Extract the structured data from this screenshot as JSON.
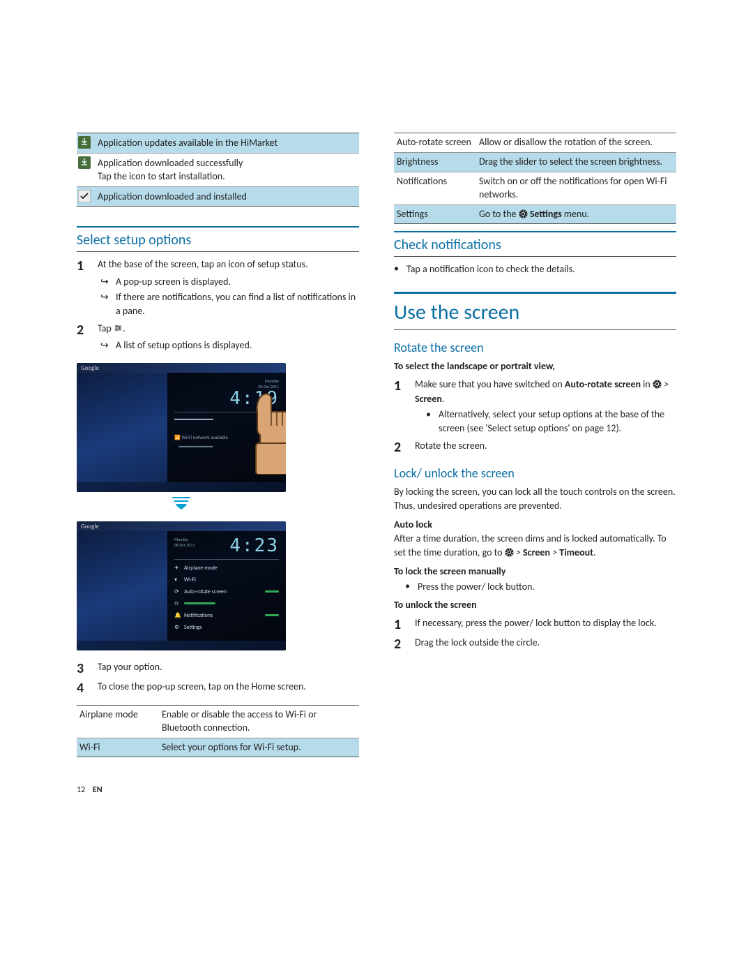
{
  "icon_rows": [
    {
      "icon": "download-available",
      "text": "Application updates available in the HiMarket"
    },
    {
      "icon": "download-done",
      "text": "Application downloaded successfully\nTap the icon to start installation."
    },
    {
      "icon": "installed",
      "text": "Application downloaded and installed"
    }
  ],
  "left": {
    "select_setup_heading": "Select setup options",
    "step1_text": "At the base of the screen, tap an icon of setup status.",
    "step1_sub1": "A pop-up screen is displayed.",
    "step1_sub2": "If there are notifications, you can find a list of notifications in a pane.",
    "step2_text_prefix": "Tap ",
    "step2_text_suffix": ".",
    "step2_sub1": "A list of setup options is displayed.",
    "step3_text": "Tap your option.",
    "step4_text": "To close the pop-up screen, tap on the Home screen.",
    "shot1": {
      "clock": "4:19",
      "search": "Google",
      "lines": [
        "Monday",
        "06 Oct 2011",
        "",
        "Wi-Fi network available"
      ]
    },
    "shot2": {
      "clock": "4:23",
      "search": "Google",
      "date1": "Monday",
      "date2": "06 Oct 2011",
      "rows": [
        {
          "icon": "✈",
          "label": "Airplane mode"
        },
        {
          "icon": "▾",
          "label": "Wi-Fi"
        },
        {
          "icon": "⟳",
          "label": "Auto-rotate screen",
          "toggle": true
        },
        {
          "icon": "☼",
          "label": "",
          "slider": true
        },
        {
          "icon": "🔔",
          "label": "Notifications",
          "toggle": true
        },
        {
          "icon": "⚙",
          "label": "Settings"
        }
      ]
    },
    "opts1": [
      {
        "k": "Airplane mode",
        "v": "Enable or disable the access to Wi-Fi or Bluetooth connection."
      },
      {
        "k": "Wi-Fi",
        "v": "Select your options for Wi-Fi setup."
      }
    ]
  },
  "right": {
    "opts2": [
      {
        "k": "Auto-rotate screen",
        "v": "Allow or disallow the rotation of the screen."
      },
      {
        "k": "Brightness",
        "v": "Drag the slider to select the screen brightness."
      },
      {
        "k": "Notifications",
        "v": "Switch on or off the notifications for open Wi-Fi networks."
      },
      {
        "k": "Settings",
        "v_prefix": "Go to the ",
        "v_bold": "Settings",
        "v_suffix": " menu.",
        "gear": true
      }
    ],
    "check_notif_heading": "Check notifications",
    "check_notif_bullet": "Tap a notification icon to check the details.",
    "use_screen_heading": "Use the screen",
    "rotate_heading": "Rotate the screen",
    "rotate_intro": "To select the landscape or portrait view,",
    "rotate_step1_prefix": "Make sure that you have switched on ",
    "rotate_step1_bold": "Auto-rotate screen",
    "rotate_step1_in": " in ",
    "rotate_step1_screen": "Screen",
    "rotate_step1_dot": ".",
    "rotate_step1_bullet": "Alternatively, select your setup options at the base of the screen (see 'Select setup options' on page 12).",
    "rotate_step2": "Rotate the screen.",
    "lock_heading": "Lock/ unlock the screen",
    "lock_para": "By locking the screen, you can lock all the touch controls on the screen. Thus, undesired operations are prevented.",
    "auto_lock_label": "Auto lock",
    "auto_lock_text_prefix": "After a time duration, the screen dims and is locked automatically. To set the time duration, go to ",
    "auto_lock_screen": "Screen",
    "auto_lock_gt": " > ",
    "auto_lock_timeout": "Timeout",
    "auto_lock_dot": ".",
    "manual_label": "To lock the screen manually",
    "manual_bullet": "Press the power/ lock button.",
    "unlock_label": "To unlock the screen",
    "unlock_step1": "If necessary, press the power/ lock button to display the lock.",
    "unlock_step2": "Drag the lock outside the circle."
  },
  "footer": {
    "page": "12",
    "lang": "EN"
  }
}
